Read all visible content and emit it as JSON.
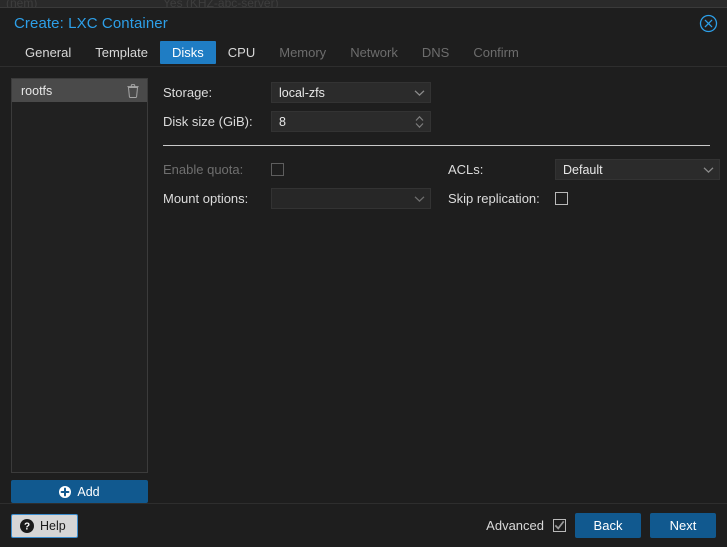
{
  "background": {
    "text_left": "(nem)",
    "text_right": "Yes (KHZ-abc-server)"
  },
  "window": {
    "title": "Create: LXC Container",
    "close_icon": "close-circle-icon"
  },
  "tabs": [
    {
      "label": "General",
      "state": "enabled"
    },
    {
      "label": "Template",
      "state": "enabled"
    },
    {
      "label": "Disks",
      "state": "active"
    },
    {
      "label": "CPU",
      "state": "enabled"
    },
    {
      "label": "Memory",
      "state": "disabled"
    },
    {
      "label": "Network",
      "state": "disabled"
    },
    {
      "label": "DNS",
      "state": "disabled"
    },
    {
      "label": "Confirm",
      "state": "disabled"
    }
  ],
  "mountpoints": {
    "items": [
      {
        "label": "rootfs",
        "selected": true,
        "delete_icon": "trash-icon"
      }
    ],
    "add_label": "Add",
    "add_icon": "plus-circle-icon"
  },
  "form": {
    "storage_label": "Storage:",
    "storage_value": "local-zfs",
    "disk_size_label": "Disk size (GiB):",
    "disk_size_value": "8",
    "enable_quota_label": "Enable quota:",
    "enable_quota_checked": false,
    "enable_quota_disabled": true,
    "mount_options_label": "Mount options:",
    "mount_options_value": "",
    "acls_label": "ACLs:",
    "acls_value": "Default",
    "skip_replication_label": "Skip replication:",
    "skip_replication_checked": false
  },
  "footer": {
    "help_label": "Help",
    "help_icon": "question-circle-icon",
    "advanced_label": "Advanced",
    "advanced_checked": true,
    "back_label": "Back",
    "next_label": "Next"
  },
  "colors": {
    "accent_blue": "#1f7dc4",
    "button_blue": "#11598f",
    "title_blue": "#2d9fe8",
    "window_bg": "#1e1e1e",
    "field_bg": "#2b2b2b",
    "selected_row": "#4a4a4a"
  }
}
